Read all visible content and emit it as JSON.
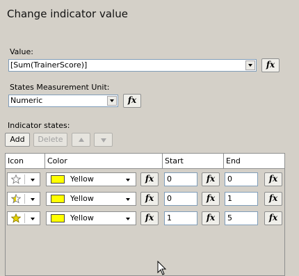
{
  "dialog": {
    "title": "Change indicator value"
  },
  "value": {
    "label": "Value:",
    "current": "[Sum(TrainerScore)]",
    "fx_label": "fx"
  },
  "measurement": {
    "label": "States Measurement Unit:",
    "current": "Numeric",
    "fx_label": "fx"
  },
  "states": {
    "label": "Indicator states:",
    "add_label": "Add",
    "delete_label": "Delete"
  },
  "grid": {
    "columns": [
      "Icon",
      "Color",
      "Start",
      "End"
    ],
    "fx_label": "fx",
    "rows": [
      {
        "icon": "star-empty-icon",
        "fill": 0.0,
        "color_name": "Yellow",
        "color_hex": "#ffff00",
        "start": "0",
        "end": "0"
      },
      {
        "icon": "star-half-icon",
        "fill": 0.5,
        "color_name": "Yellow",
        "color_hex": "#ffff00",
        "start": "0",
        "end": "1"
      },
      {
        "icon": "star-full-icon",
        "fill": 1.0,
        "color_name": "Yellow",
        "color_hex": "#ffff00",
        "start": "1",
        "end": "5"
      }
    ]
  },
  "colors": {
    "dialog_bg": "#d4d0c8",
    "field_border": "#7f9db9",
    "star_fill": "#e8d400"
  }
}
